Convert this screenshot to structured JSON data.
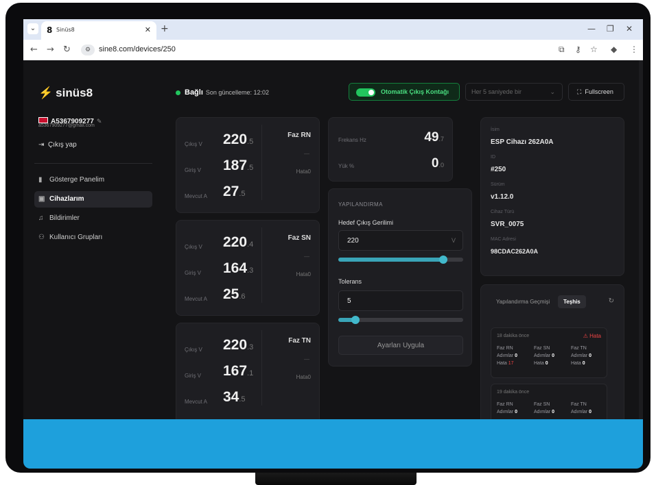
{
  "browser": {
    "tab_title": "Sinüs8",
    "tab_favicon": "8",
    "url": "sine8.com/devices/250",
    "site_icon": "site-settings-icon"
  },
  "sidebar": {
    "brand": "sinüs8",
    "brand_icon": "⚡",
    "username": "A5367909277",
    "email": "a5367909277@gmail.com",
    "logout_label": "Çıkış yap",
    "items": [
      {
        "label": "Gösterge Panelim",
        "icon": "chart-icon"
      },
      {
        "label": "Cihazlarım",
        "icon": "devices-icon",
        "active": true
      },
      {
        "label": "Bildirimler",
        "icon": "bell-icon"
      },
      {
        "label": "Kullanıcı Grupları",
        "icon": "users-icon"
      }
    ]
  },
  "header": {
    "status": "Bağlı",
    "status_color": "#22c55e",
    "last_update": "Son güncelleme: 12:02",
    "auto_label": "Otomatik Çıkış Kontağı",
    "interval_placeholder": "Her 5 saniyede bir",
    "fullscreen_label": "Fullscreen"
  },
  "phases": [
    {
      "name": "Faz RN",
      "dash": "—",
      "hata": "Hata0",
      "rows": [
        {
          "label": "Çıkış V",
          "int": "220",
          "dec": ".5"
        },
        {
          "label": "Giriş V",
          "int": "187",
          "dec": ".5"
        },
        {
          "label": "Mevcut A",
          "int": "27",
          "dec": ".5"
        }
      ]
    },
    {
      "name": "Faz SN",
      "dash": "—",
      "hata": "Hata0",
      "rows": [
        {
          "label": "Çıkış V",
          "int": "220",
          "dec": ".4"
        },
        {
          "label": "Giriş V",
          "int": "164",
          "dec": ".3"
        },
        {
          "label": "Mevcut A",
          "int": "25",
          "dec": ".6"
        }
      ]
    },
    {
      "name": "Faz TN",
      "dash": "—",
      "hata": "Hata0",
      "rows": [
        {
          "label": "Çıkış V",
          "int": "220",
          "dec": ".3"
        },
        {
          "label": "Giriş V",
          "int": "167",
          "dec": ".1"
        },
        {
          "label": "Mevcut A",
          "int": "34",
          "dec": ".5"
        }
      ]
    }
  ],
  "metrics": {
    "freq_label": "Frekans Hz",
    "freq_int": "49",
    "freq_dec": ".7",
    "load_label": "Yük %",
    "load_int": "0",
    "load_dec": ".0"
  },
  "config": {
    "heading": "YAPILANDIRMA",
    "target_label": "Hedef Çıkış Gerilimi",
    "target_value": "220",
    "target_unit": "V",
    "target_slider": 0.84,
    "tolerance_label": "Tolerans",
    "tolerance_value": "5",
    "tolerance_slider": 0.14,
    "apply_label": "Ayarları Uygula"
  },
  "device": {
    "name_label": "İsim",
    "name": "ESP Cihazı 262A0A",
    "id_label": "ID",
    "id": "#250",
    "version_label": "Sürüm",
    "version": "v1.12.0",
    "type_label": "Cihaz Türü",
    "type": "SVR_0075",
    "mac_label": "MAC Adresi",
    "mac": "98CDAC262A0A"
  },
  "history": {
    "tab_config": "Yapılandırma Geçmişi",
    "tab_diag": "Teşhis",
    "items": [
      {
        "time": "18 dakika önce",
        "error": "⚠ Hata",
        "cols": [
          {
            "name": "Faz RN",
            "steps": "Adımlar",
            "steps_n": "0",
            "err": "Hata",
            "err_n": "17"
          },
          {
            "name": "Faz SN",
            "steps": "Adımlar",
            "steps_n": "0",
            "err": "Hata",
            "err_n": "0"
          },
          {
            "name": "Faz TN",
            "steps": "Adımlar",
            "steps_n": "0",
            "err": "Hata",
            "err_n": "0"
          }
        ]
      },
      {
        "time": "19 dakika önce",
        "error": "",
        "cols": [
          {
            "name": "Faz RN",
            "steps": "Adımlar",
            "steps_n": "0"
          },
          {
            "name": "Faz SN",
            "steps": "Adımlar",
            "steps_n": "0"
          },
          {
            "name": "Faz TN",
            "steps": "Adımlar",
            "steps_n": "0"
          }
        ]
      }
    ]
  }
}
